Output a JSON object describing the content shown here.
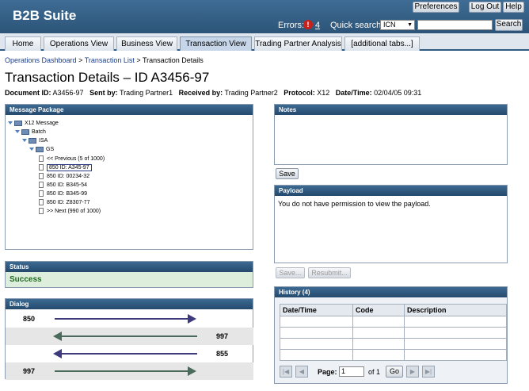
{
  "header": {
    "title": "B2B Suite",
    "preferences_label": "Preferences",
    "logout_label": "Log Out",
    "help_label": "Help",
    "errors_label": "Errors:",
    "errors_icon": "!",
    "errors_count": "4",
    "quick_search_label": "Quick search:",
    "quick_search_type": "ICN",
    "quick_search_value": "",
    "search_label": "Search"
  },
  "tabs": [
    {
      "label": "Home"
    },
    {
      "label": "Operations View"
    },
    {
      "label": "Business View"
    },
    {
      "label": "Transaction View"
    },
    {
      "label": "Trading Partner Analysis"
    },
    {
      "label": "[additional tabs...]"
    }
  ],
  "breadcrumb": {
    "items": [
      "Operations Dashboard",
      "Transaction List",
      "Transaction Details"
    ],
    "separator": ">"
  },
  "page": {
    "title": "Transaction Details – ID A3456-97",
    "doc_id_label": "Document ID:",
    "doc_id_value": "A3456-97",
    "sent_by_label": "Sent by:",
    "sent_by_value": "Trading Partner1",
    "received_by_label": "Received by:",
    "received_by_value": "Trading Partner2",
    "protocol_label": "Protocol:",
    "protocol_value": "X12",
    "datetime_label": "Date/Time:",
    "datetime_value": "02/04/05 09:31"
  },
  "message_package": {
    "title": "Message Package",
    "tree": {
      "root": "X12 Message",
      "batch": "Batch",
      "isa": "ISA",
      "gs": "GS",
      "items": [
        "<< Previous (5 of 1000)",
        "850 ID: A345-97",
        "850 ID: 00234-32",
        "850 ID: B345-54",
        "850 ID: B345-99",
        "850 ID: Z8307-77",
        ">> Next (990 of 1000)"
      ]
    }
  },
  "status": {
    "title": "Status",
    "value": "Success"
  },
  "dialog": {
    "title": "Dialog",
    "rows": [
      {
        "label": "850",
        "direction": "right",
        "color": "#3d3b7c"
      },
      {
        "label": "997",
        "direction": "left",
        "color": "#4a6b5c"
      },
      {
        "label": "855",
        "direction": "left",
        "color": "#3d3b7c"
      },
      {
        "label": "997",
        "direction": "right",
        "color": "#4a6b5c"
      }
    ]
  },
  "notes": {
    "title": "Notes",
    "value": "",
    "save_label": "Save"
  },
  "payload": {
    "title": "Payload",
    "message": "You do not have permission to view the payload.",
    "save_label": "Save...",
    "resubmit_label": "Resubmit..."
  },
  "history": {
    "title": "History (4)",
    "columns": [
      "Date/Time",
      "Code",
      "Description"
    ],
    "rows": [
      [
        "",
        "",
        ""
      ],
      [
        "",
        "",
        ""
      ],
      [
        "",
        "",
        ""
      ],
      [
        "",
        "",
        ""
      ]
    ],
    "pager": {
      "page_label": "Page:",
      "page_value": "1",
      "of_label": "of",
      "total_pages": "1",
      "go_label": "Go",
      "first_icon": "first-page-icon",
      "prev_icon": "prev-page-icon",
      "next_icon": "next-page-icon",
      "last_icon": "last-page-icon"
    }
  },
  "colors": {
    "header_bg": "#2f5b82",
    "panel_header_bg": "#2c5478",
    "status_bg": "#ddeedd",
    "status_text": "#1d6b1d",
    "error_icon": "#c8201a"
  }
}
